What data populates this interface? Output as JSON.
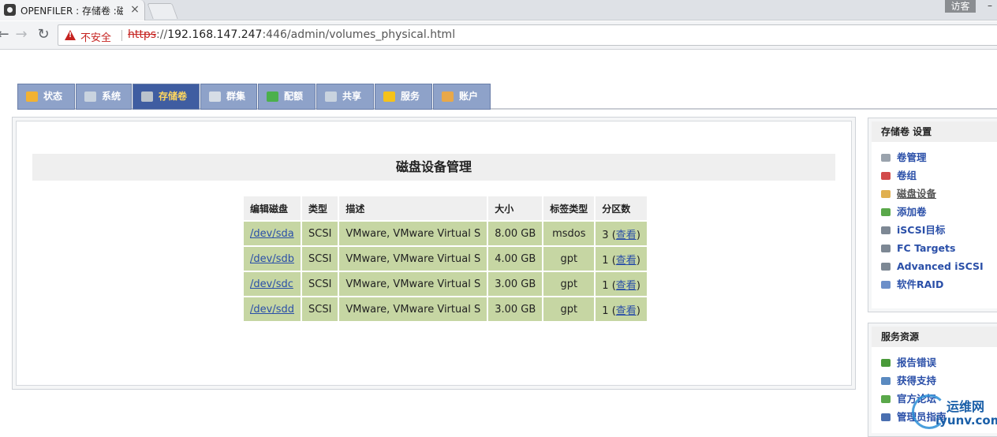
{
  "browser": {
    "tab_title": "OPENFILER : 存储卷 :磁",
    "tab_close": "×",
    "guest_label": "访客",
    "window_min": "–",
    "nav_back": "←",
    "nav_forward": "→",
    "nav_reload": "↻",
    "security_label": "不安全",
    "url_scheme": "https",
    "url_sep": "://",
    "url_host": "192.168.147.247",
    "url_rest": ":446/admin/volumes_physical.html"
  },
  "nav": {
    "tabs": [
      {
        "label": "状态",
        "icon": "sun-cloud-icon",
        "color": "#f2b233"
      },
      {
        "label": "系统",
        "icon": "monitor-icon",
        "color": "#c9d3df"
      },
      {
        "label": "存储卷",
        "icon": "disk-drive-icon",
        "color": "#b9c2cc"
      },
      {
        "label": "群集",
        "icon": "cluster-icon",
        "color": "#d6dde6"
      },
      {
        "label": "配额",
        "icon": "pie-chart-icon",
        "color": "#4bb04b"
      },
      {
        "label": "共享",
        "icon": "share-drive-icon",
        "color": "#c9d3df"
      },
      {
        "label": "服务",
        "icon": "lightning-icon",
        "color": "#f5c21a"
      },
      {
        "label": "账户",
        "icon": "user-key-icon",
        "color": "#e8a84a"
      }
    ],
    "active_index": 2
  },
  "main": {
    "title": "磁盘设备管理",
    "table": {
      "headers": [
        "编辑磁盘",
        "类型",
        "描述",
        "大小",
        "标签类型",
        "分区数"
      ],
      "rows": [
        {
          "disk": "/dev/sda",
          "type": "SCSI",
          "description": "VMware, VMware Virtual S",
          "size": "8.00 GB",
          "label_type": "msdos",
          "partitions": "3",
          "view": "查看"
        },
        {
          "disk": "/dev/sdb",
          "type": "SCSI",
          "description": "VMware, VMware Virtual S",
          "size": "4.00 GB",
          "label_type": "gpt",
          "partitions": "1",
          "view": "查看"
        },
        {
          "disk": "/dev/sdc",
          "type": "SCSI",
          "description": "VMware, VMware Virtual S",
          "size": "3.00 GB",
          "label_type": "gpt",
          "partitions": "1",
          "view": "查看"
        },
        {
          "disk": "/dev/sdd",
          "type": "SCSI",
          "description": "VMware, VMware Virtual S",
          "size": "3.00 GB",
          "label_type": "gpt",
          "partitions": "1",
          "view": "查看"
        }
      ]
    }
  },
  "sidebar": {
    "settings": {
      "title": "存储卷 设置",
      "items": [
        {
          "label": "卷管理",
          "icon": "drive-icon",
          "color": "#9aa3ad"
        },
        {
          "label": "卷组",
          "icon": "volume-group-icon",
          "color": "#d24a4a"
        },
        {
          "label": "磁盘设备",
          "icon": "disk-device-icon",
          "color": "#e0b050"
        },
        {
          "label": "添加卷",
          "icon": "add-volume-icon",
          "color": "#5aa84a"
        },
        {
          "label": "iSCSI目标",
          "icon": "iscsi-icon",
          "color": "#7d8894"
        },
        {
          "label": "FC Targets",
          "icon": "fc-icon",
          "color": "#7d8894"
        },
        {
          "label": "Advanced iSCSI",
          "icon": "advanced-iscsi-icon",
          "color": "#7d8894"
        },
        {
          "label": "软件RAID",
          "icon": "raid-icon",
          "color": "#6c8fc9"
        }
      ],
      "current_index": 2
    },
    "resources": {
      "title": "服务资源",
      "items": [
        {
          "label": "报告错误",
          "icon": "bug-icon",
          "color": "#4a9a3a"
        },
        {
          "label": "获得支持",
          "icon": "support-icon",
          "color": "#5a8ac0"
        },
        {
          "label": "官方论坛",
          "icon": "forum-icon",
          "color": "#5aa84a"
        },
        {
          "label": "管理员指南",
          "icon": "guide-icon",
          "color": "#4a6fb0"
        }
      ]
    }
  },
  "watermark": {
    "top": "运维网",
    "bottom": "iyunv.com"
  },
  "colors": {
    "nav_tab": "#8ea2c9",
    "nav_tab_active": "#3f5da1",
    "nav_active_text": "#ffd75e",
    "table_cell": "#c6d6a3",
    "link": "#2a4fa8",
    "insecure": "#c5221f"
  }
}
